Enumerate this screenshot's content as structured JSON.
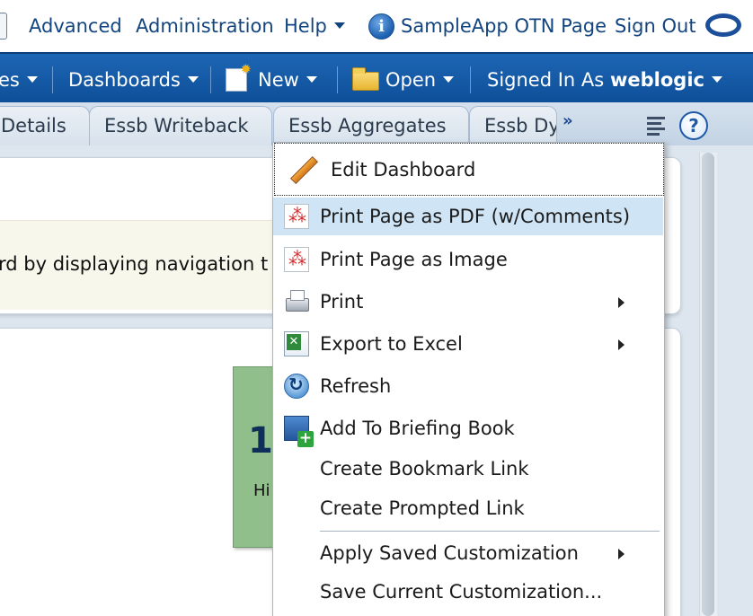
{
  "top_links": {
    "advanced": "Advanced",
    "administration": "Administration",
    "help": "Help",
    "otn_page": "SampleApp OTN Page",
    "sign_out": "Sign Out"
  },
  "header": {
    "catalog_tail": "es",
    "dashboards": "Dashboards",
    "new": "New",
    "open": "Open",
    "signed_in_as": "Signed In As",
    "user": "weblogic"
  },
  "tabs": [
    {
      "label": "Details"
    },
    {
      "label": "Essb Writeback"
    },
    {
      "label": "Essb Aggregates"
    },
    {
      "label": "Essb Dyr"
    }
  ],
  "content": {
    "instruction_text": "rd by displaying navigation t",
    "tile_value": "1",
    "tile_label": "Hi"
  },
  "menu": {
    "edit_dashboard": "Edit Dashboard",
    "items": [
      {
        "label": "Print Page as PDF (w/Comments)"
      },
      {
        "label": "Print Page as Image"
      },
      {
        "label": "Print"
      },
      {
        "label": "Export to Excel"
      },
      {
        "label": "Refresh"
      },
      {
        "label": "Add To Briefing Book"
      },
      {
        "label": "Create Bookmark Link"
      },
      {
        "label": "Create Prompted Link"
      },
      {
        "label": "Apply Saved Customization"
      },
      {
        "label": "Save Current Customization..."
      }
    ]
  },
  "colors": {
    "header_blue": "#1d66b4",
    "link_blue": "#12457f",
    "menu_highlight": "#cfe4f5",
    "tile_green": "#91bf8c"
  },
  "icons": {
    "edit": "pencil-icon",
    "pdf": "pdf-icon",
    "print": "printer-icon",
    "excel": "excel-icon",
    "refresh": "refresh-icon",
    "briefing": "briefing-book-icon"
  }
}
